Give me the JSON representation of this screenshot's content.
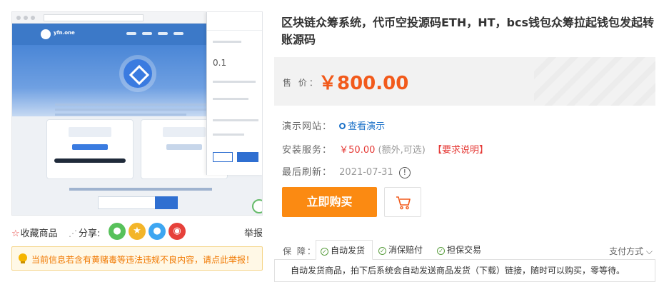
{
  "product": {
    "title": "区块链众筹系统，代币空投源码ETH，HT，bcs钱包众筹拉起钱包发起转账源码",
    "price_label": "售 价：",
    "price": "￥800.00"
  },
  "preview": {
    "site_name": "yfn.one",
    "wallet_amount": "0.1"
  },
  "info": {
    "demo_label": "演示网站：",
    "demo_link": "查看演示",
    "install_label": "安装服务：",
    "install_price": "￥50.00",
    "install_note": "(额外,可选)",
    "install_req": "【要求说明】",
    "refresh_label": "最后刷新：",
    "refresh_date": "2021-07-31",
    "refresh_icon": "!"
  },
  "buttons": {
    "buy": "立即购买"
  },
  "actions": {
    "favorite": "收藏商品",
    "share": "分享:",
    "report": "举报"
  },
  "warning": "当前信息若含有黄赌毒等违法违规不良内容，请点此举报！",
  "guarantee": {
    "label": "保 障：",
    "tabs": [
      "自动发货",
      "消保赔付",
      "担保交易"
    ],
    "payment": "支付方式",
    "description": "自动发货商品，拍下后系统会自动发送商品发货（下载）链接，随时可以购买，零等待。"
  },
  "colors": {
    "price": "#f25a1b",
    "buy_button": "#fb8a12",
    "warning_text": "#f07800",
    "link": "#1e73c9"
  }
}
